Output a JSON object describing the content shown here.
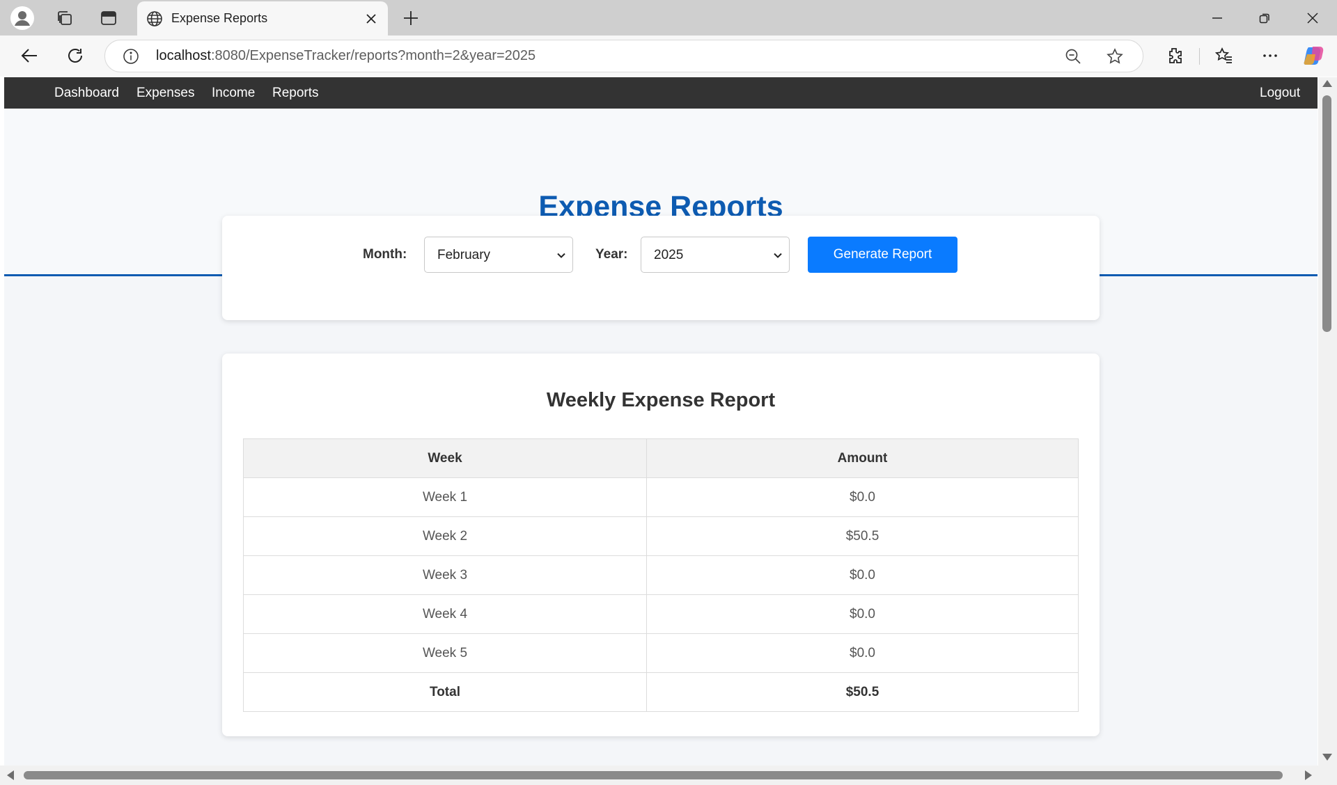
{
  "browser": {
    "tab": {
      "title": "Expense Reports",
      "icon": "globe-icon"
    },
    "url": {
      "host": "localhost",
      "rest": ":8080/ExpenseTracker/reports?month=2&year=2025"
    },
    "icons": [
      "profile-icon",
      "workspaces-icon",
      "vertical-tabs-icon",
      "close-icon",
      "new-tab-icon",
      "minimize-icon",
      "restore-icon",
      "back-icon",
      "refresh-icon",
      "info-icon",
      "zoom-out-icon",
      "favorite-star-icon",
      "extensions-icon",
      "favorites-icon",
      "more-icon",
      "copilot-icon"
    ]
  },
  "nav": {
    "items": [
      {
        "label": "Dashboard"
      },
      {
        "label": "Expenses"
      },
      {
        "label": "Income"
      },
      {
        "label": "Reports"
      }
    ],
    "logout": "Logout"
  },
  "header": {
    "title": "Expense Reports"
  },
  "filters": {
    "month_label": "Month:",
    "month_value": "February",
    "year_label": "Year:",
    "year_value": "2025",
    "button": "Generate Report"
  },
  "report": {
    "title": "Weekly Expense Report",
    "columns": [
      "Week",
      "Amount"
    ],
    "rows": [
      {
        "week": "Week 1",
        "amount": "$0.0"
      },
      {
        "week": "Week 2",
        "amount": "$50.5"
      },
      {
        "week": "Week 3",
        "amount": "$0.0"
      },
      {
        "week": "Week 4",
        "amount": "$0.0"
      },
      {
        "week": "Week 5",
        "amount": "$0.0"
      }
    ],
    "total": {
      "label": "Total",
      "amount": "$50.5"
    }
  },
  "colors": {
    "navbar": "#333333",
    "title": "#0d5bb1",
    "button": "#0a7bff",
    "page_bg": "#f4f6f9"
  }
}
